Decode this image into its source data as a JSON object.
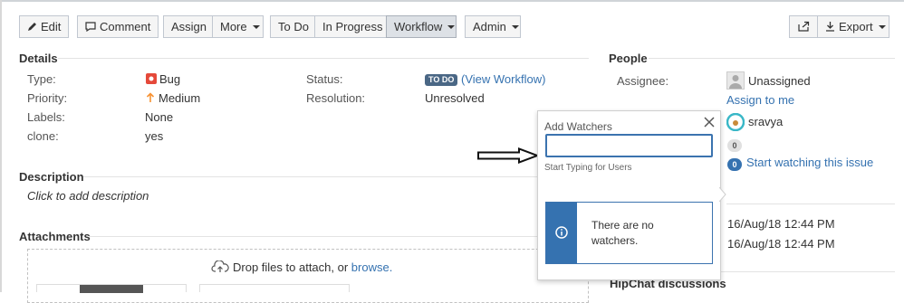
{
  "toolbar": {
    "edit": "Edit",
    "comment": "Comment",
    "assign": "Assign",
    "more": "More",
    "todo": "To Do",
    "in_progress": "In Progress",
    "workflow": "Workflow",
    "admin": "Admin",
    "export": "Export"
  },
  "details": {
    "heading": "Details",
    "type_label": "Type:",
    "type_value": "Bug",
    "priority_label": "Priority:",
    "priority_value": "Medium",
    "labels_label": "Labels:",
    "labels_value": "None",
    "clone_label": "clone:",
    "clone_value": "yes",
    "status_label": "Status:",
    "status_lozenge": "TO DO",
    "view_workflow_prefix": "(",
    "view_workflow": "View Workflow",
    "view_workflow_suffix": ")",
    "resolution_label": "Resolution:",
    "resolution_value": "Unresolved"
  },
  "description": {
    "heading": "Description",
    "placeholder": "Click to add description"
  },
  "attachments": {
    "heading": "Attachments",
    "drop_text": "Drop files to attach, or",
    "browse": "browse."
  },
  "people": {
    "heading": "People",
    "assignee_label": "Assignee:",
    "assignee_value": "Unassigned",
    "assign_to_me": "Assign to me",
    "reporter": "sravya",
    "votes_count": "0",
    "watchers_count": "0",
    "start_watching": "Start watching this issue"
  },
  "dates": {
    "created": "16/Aug/18 12:44 PM",
    "updated": "16/Aug/18 12:44 PM"
  },
  "hipchat": {
    "heading": "HipChat discussions"
  },
  "popup": {
    "title": "Add Watchers",
    "input_value": "",
    "hint": "Start Typing for Users",
    "info_line1": "There are no",
    "info_line2": "watchers."
  },
  "colors": {
    "link": "#3572b0",
    "lozenge": "#4a6785",
    "bug": "#e5493a",
    "priority": "#f79232",
    "info_stripe": "#3572b0"
  }
}
